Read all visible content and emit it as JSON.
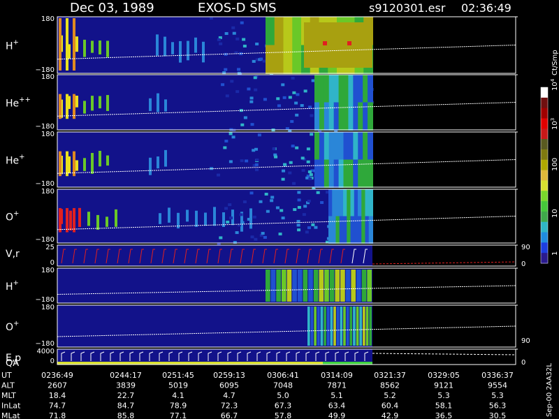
{
  "header": {
    "date": "Dec 03, 1989",
    "instrument": "EXOS-D SMS",
    "file": "s9120301.esr",
    "time": "02:36:49"
  },
  "colorbar": {
    "unit": "Ct/Smp",
    "ticks": [
      {
        "base": "1",
        "exp": ""
      },
      {
        "base": "10",
        "exp": ""
      },
      {
        "base": "100",
        "exp": ""
      },
      {
        "base": "10",
        "exp": "3"
      },
      {
        "base": "10",
        "exp": "4"
      }
    ],
    "colors": [
      "#2a1a8e",
      "#1d3ee0",
      "#1f8ce0",
      "#2fb6c6",
      "#3fa84a",
      "#46c83a",
      "#7ad82c",
      "#d8e030",
      "#e0b83a",
      "#b0a800",
      "#807a10",
      "#5a5a20",
      "#c81818",
      "#e00000",
      "#a00000",
      "#701010",
      "#ffffff"
    ]
  },
  "chart_data": {
    "type": "heatmap",
    "panels": [
      {
        "label": "H",
        "sup": "+",
        "ymax": "180",
        "ymin": "−180"
      },
      {
        "label": "He",
        "sup": "++",
        "ymax": "180",
        "ymin": "−180"
      },
      {
        "label": "He",
        "sup": "+",
        "ymax": "180",
        "ymin": "−180"
      },
      {
        "label": "O",
        "sup": "+",
        "ymax": "180",
        "ymin": "−180"
      },
      {
        "label": "V,r",
        "sup": "",
        "ymax": "25",
        "ymin": "0",
        "right_top": "90",
        "right_bottom": "0"
      },
      {
        "label": "H",
        "sup": "+",
        "ymax": "180",
        "ymin": "−180"
      },
      {
        "label": "O",
        "sup": "+",
        "ymax": "180",
        "ymin": "−180",
        "right_mid": "90"
      },
      {
        "label": "E,p",
        "sup": "",
        "label2": "QA",
        "ymax": "4000",
        "ymin": "0",
        "right_bottom": "0"
      }
    ],
    "footer": {
      "UT": [
        "0236:49",
        "0244:17",
        "0251:45",
        "0259:13",
        "0306:41",
        "0314:09",
        "0321:37",
        "0329:05",
        "0336:37"
      ],
      "ALT": [
        "2607",
        "3839",
        "5019",
        "6095",
        "7048",
        "7871",
        "8562",
        "9121",
        "9554"
      ],
      "MLT": [
        "18.4",
        "22.7",
        "4.1",
        "4.7",
        "5.0",
        "5.1",
        "5.2",
        "5.3",
        "5.3"
      ],
      "InLat": [
        "74.7",
        "84.7",
        "78.9",
        "72.3",
        "67.3",
        "63.4",
        "60.4",
        "58.1",
        "56.3"
      ],
      "MLat": [
        "71.8",
        "85.8",
        "77.1",
        "66.7",
        "57.8",
        "49.9",
        "42.9",
        "36.5",
        "30.5"
      ]
    },
    "footer_labels": [
      "UT",
      "ALT",
      "MLT",
      "InLat",
      "MLat"
    ],
    "side_note": "Sep-00  2AA32L"
  }
}
